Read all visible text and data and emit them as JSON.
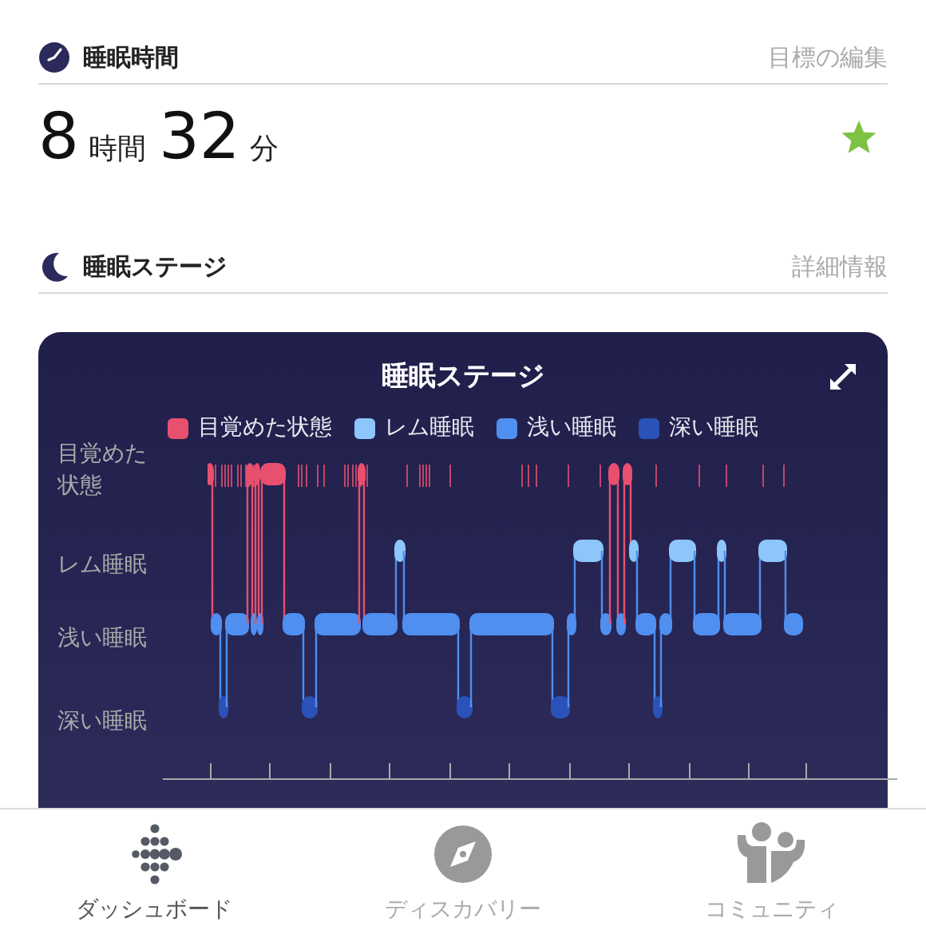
{
  "sleep_duration": {
    "title": "睡眠時間",
    "action": "目標の編集",
    "hours": "8",
    "hours_unit": "時間",
    "minutes": "32",
    "minutes_unit": "分",
    "goal_met": true
  },
  "sleep_stages": {
    "title": "睡眠ステージ",
    "action": "詳細情報"
  },
  "chart_card": {
    "title": "睡眠ステージ",
    "legend": [
      {
        "label": "目覚めた状態",
        "color": "#e8506f"
      },
      {
        "label": "レム睡眠",
        "color": "#8ec5fb"
      },
      {
        "label": "浅い睡眠",
        "color": "#4f8ff0"
      },
      {
        "label": "深い睡眠",
        "color": "#2a52b8"
      }
    ],
    "stage_labels": [
      "目覚めた状態",
      "レム睡眠",
      "浅い睡眠",
      "深い睡眠"
    ]
  },
  "tab_bar": [
    {
      "label": "ダッシュボード",
      "kind": "dashboard",
      "selected": true
    },
    {
      "label": "ディスカバリー",
      "kind": "discover",
      "selected": false
    },
    {
      "label": "コミュニティ",
      "kind": "community",
      "selected": false
    }
  ]
}
